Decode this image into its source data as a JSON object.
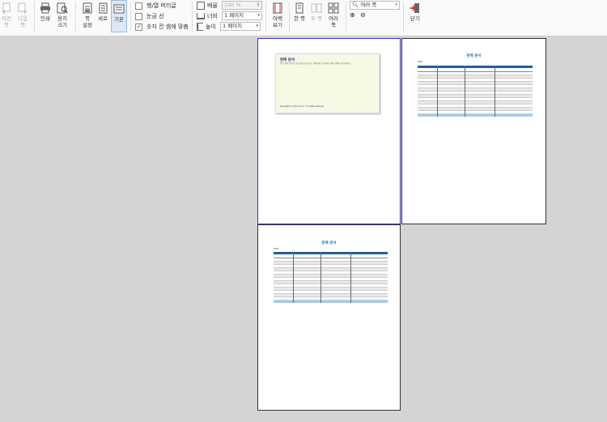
{
  "toolbar": {
    "prev_page": "이전 쪽",
    "next_page": "다음 쪽",
    "print": "인쇄",
    "paper_size": "용지 크기",
    "page_setup": "쪽 설정",
    "portrait": "세로",
    "default_view": "기본",
    "header_footer": "행/열 머리글",
    "gridlines": "눈금 선",
    "fit_numbers": "숫자 칸 셈에 맞춤",
    "scale_label": "배율",
    "scale_value": "100 %",
    "width_label": "너비",
    "width_value": "1 페이지",
    "height_label": "높이",
    "height_value": "1 페이지",
    "margin_view": "여백 보기",
    "one_page": "한 쪽",
    "two_pages": "두 쪽",
    "multi_pages": "여러 쪽",
    "zoom_value": "여러 쪽",
    "close": "닫기"
  },
  "pages": {
    "note_title": "판매 분석",
    "note_body": "월간 판매 분석을 위한 템플릿입니다. 데이터를 입력하여 판매 현황을 확인하세요.",
    "note_footer": "Copyright (c) Hancom Inc. All rights reserved.",
    "report_title": "판매 분석"
  }
}
